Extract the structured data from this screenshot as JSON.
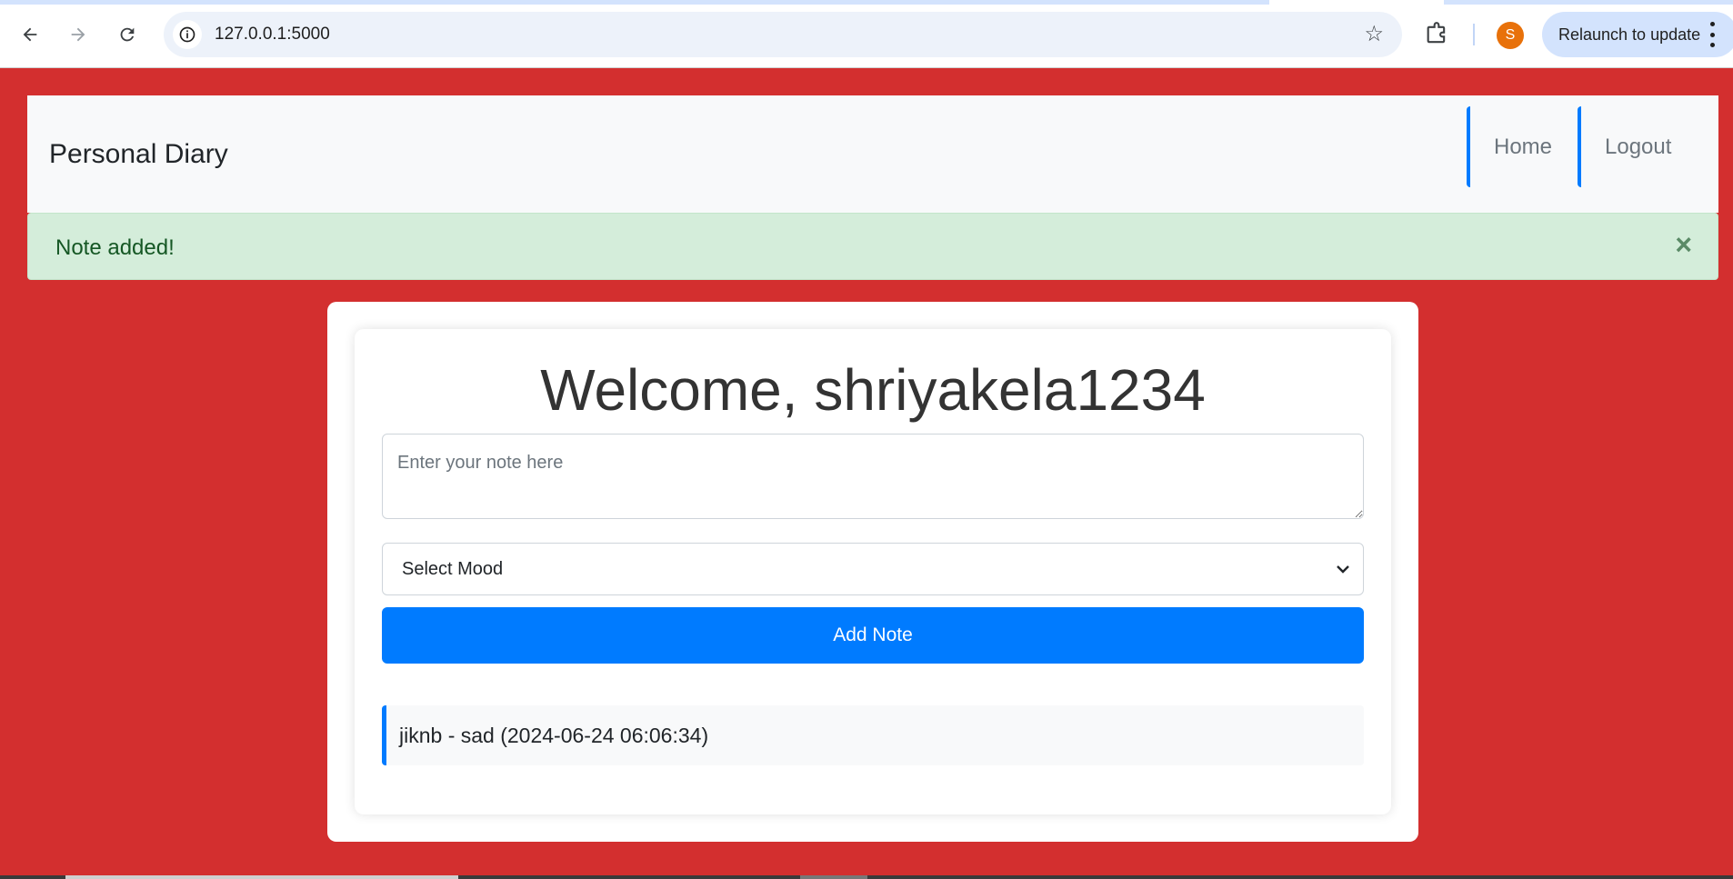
{
  "browser": {
    "url": "127.0.0.1:5000",
    "profile_initial": "S",
    "relaunch_label": "Relaunch to update",
    "icons": [
      "back-arrow-icon",
      "forward-arrow-icon",
      "reload-icon",
      "site-info-icon",
      "star-icon",
      "extensions-icon",
      "kebab-menu-icon"
    ]
  },
  "navbar": {
    "brand": "Personal Diary",
    "links": [
      {
        "label": "Home"
      },
      {
        "label": "Logout"
      }
    ]
  },
  "alert": {
    "message": "Note added!",
    "close_symbol": "×"
  },
  "main": {
    "welcome": "Welcome, shriyakela1234",
    "note_placeholder": "Enter your note here",
    "mood_selected": "Select Mood",
    "add_button_label": "Add Note",
    "notes": [
      {
        "text": "jiknb - sad (2024-06-24 06:06:34)"
      }
    ]
  },
  "colors": {
    "page_background": "#d32f2f",
    "primary": "#007bff",
    "alert_bg": "#d4edda",
    "alert_text": "#155724"
  }
}
